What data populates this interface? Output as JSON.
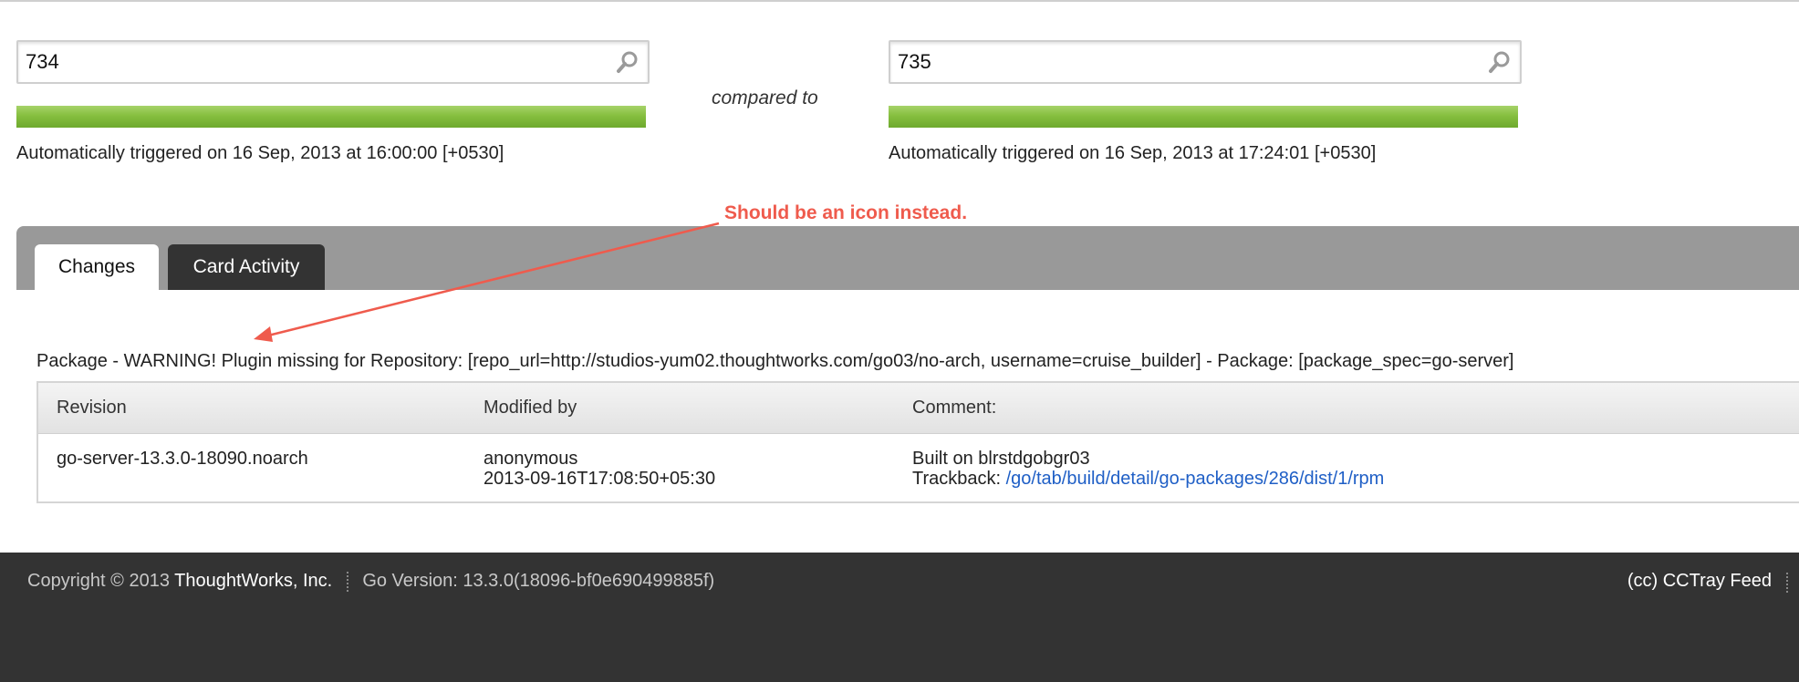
{
  "left_pipeline": {
    "search_value": "734",
    "progress": 1.0,
    "status_color": "#86bf3f",
    "trigger_text": "Automatically triggered on 16 Sep, 2013 at 16:00:00 [+0530]"
  },
  "right_pipeline": {
    "search_value": "735",
    "progress": 1.0,
    "status_color": "#86bf3f",
    "trigger_text": "Automatically triggered on 16 Sep, 2013 at 17:24:01 [+0530]"
  },
  "compared_to_label": "compared to",
  "annotation": {
    "text": "Should be an icon instead.",
    "color": "#ef5b4d"
  },
  "tabs": [
    {
      "label": "Changes",
      "active": true
    },
    {
      "label": "Card Activity",
      "active": false
    }
  ],
  "package_warning": "Package - WARNING! Plugin missing for Repository: [repo_url=http://studios-yum02.thoughtworks.com/go03/no-arch, username=cruise_builder] - Package: [package_spec=go-server]",
  "changes_table": {
    "headers": [
      "Revision",
      "Modified by",
      "Comment:"
    ],
    "rows": [
      {
        "revision": "go-server-13.3.0-18090.noarch",
        "modified_by": "anonymous",
        "modified_at": "2013-09-16T17:08:50+05:30",
        "comment": "Built on blrstdgobgr03",
        "trackback_label": "Trackback:",
        "trackback_link": "/go/tab/build/detail/go-packages/286/dist/1/rpm"
      }
    ]
  },
  "footer": {
    "copyright": "Copyright © 2013",
    "company": "ThoughtWorks, Inc.",
    "version": "Go Version: 13.3.0(18096-bf0e690499885f)",
    "cctray": "(cc) CCTray Feed"
  },
  "icons": {
    "search": "search-icon"
  }
}
